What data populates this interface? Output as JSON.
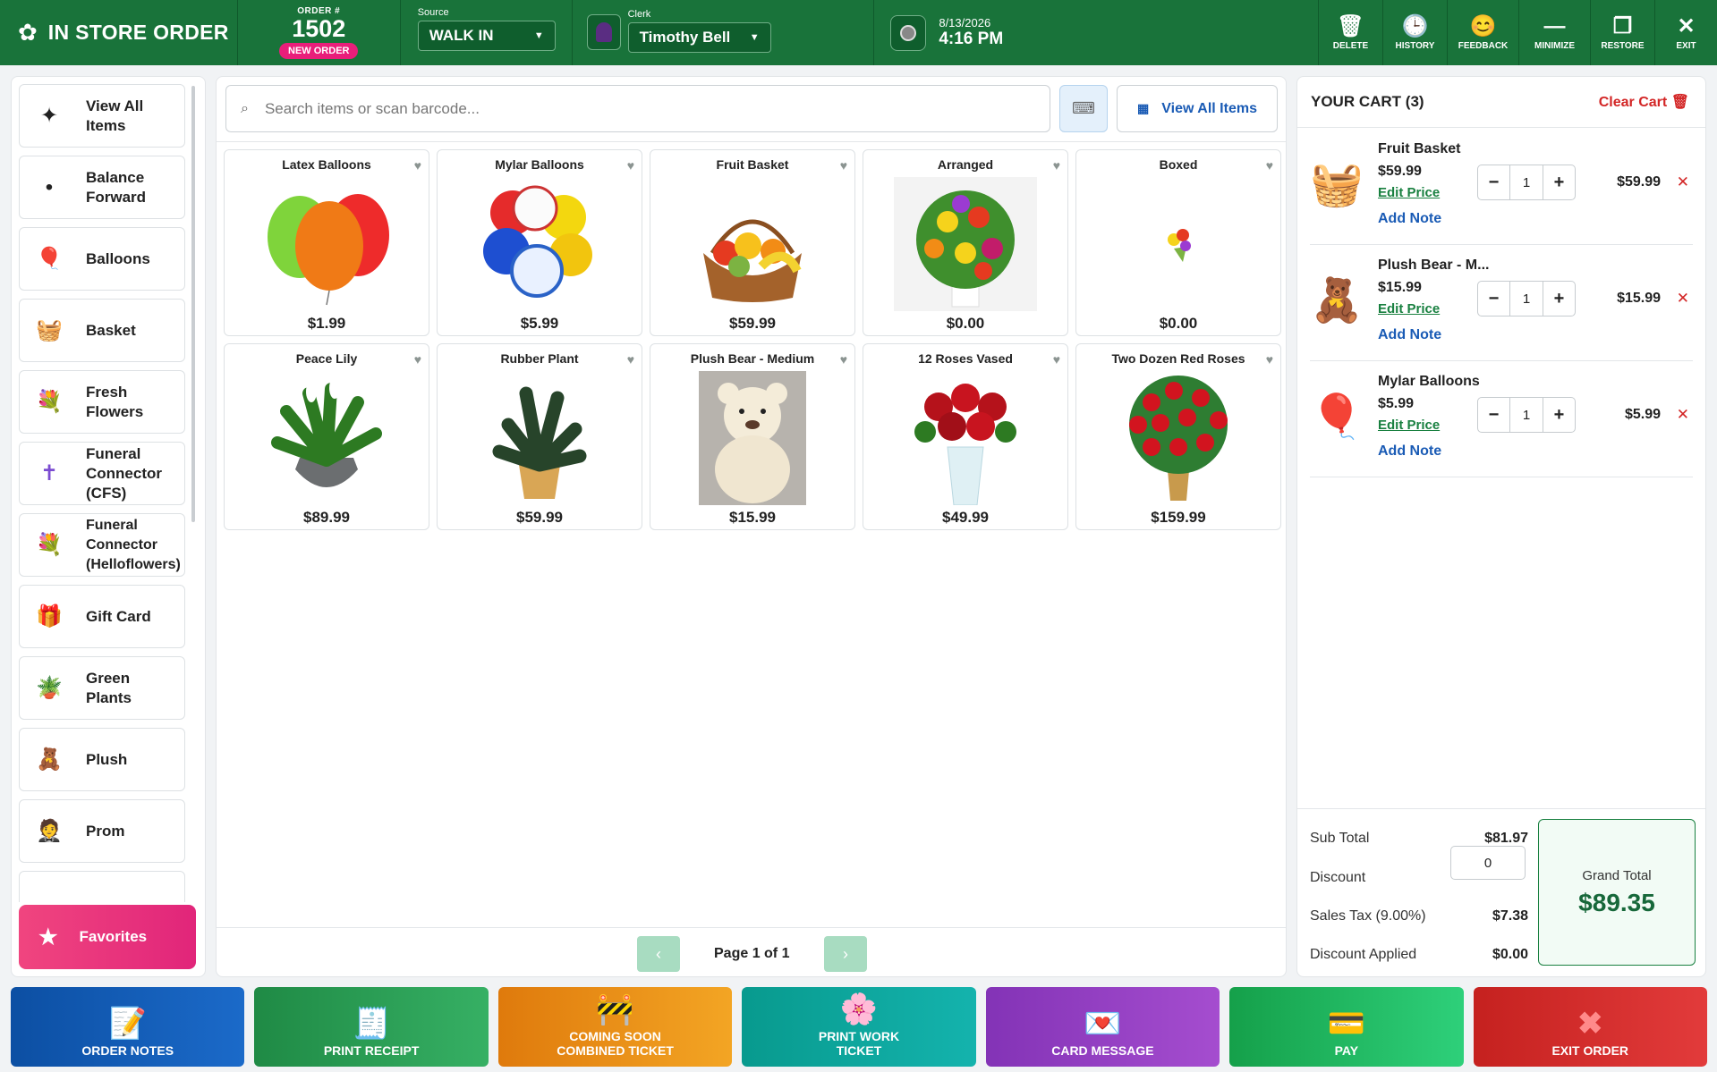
{
  "header": {
    "title": "IN STORE ORDER",
    "order_label": "ORDER #",
    "order_number": "1502",
    "order_badge": "NEW ORDER",
    "source_label": "Source",
    "source_value": "WALK IN",
    "clerk_label": "Clerk",
    "clerk_value": "Timothy Bell",
    "date": "8/13/2026",
    "time": "4:16 PM",
    "actions": {
      "delete": "DELETE",
      "history": "HISTORY",
      "feedback": "FEEDBACK",
      "minimize": "MINIMIZE",
      "restore": "RESTORE",
      "exit": "EXIT"
    }
  },
  "categories": [
    {
      "label": "View All Items",
      "icon": "sparkle-icon",
      "glyph": "✦"
    },
    {
      "label": "Balance Forward",
      "icon": "dot-icon",
      "glyph": "•"
    },
    {
      "label": "Balloons",
      "icon": "balloon-icon",
      "glyph": "🎈"
    },
    {
      "label": "Basket",
      "icon": "basket-icon",
      "glyph": "🧺"
    },
    {
      "label": "Fresh Flowers",
      "icon": "bouquet-icon",
      "glyph": "💐"
    },
    {
      "label": "Funeral Connector (CFS)",
      "icon": "cross-icon",
      "glyph": "✝"
    },
    {
      "label": "Funeral Connector (Helloflowers)",
      "icon": "bouquet-icon",
      "glyph": "💐"
    },
    {
      "label": "Gift Card",
      "icon": "gift-icon",
      "glyph": "🎁"
    },
    {
      "label": "Green Plants",
      "icon": "potted-plant-icon",
      "glyph": "🪴"
    },
    {
      "label": "Plush",
      "icon": "teddy-bear-icon",
      "glyph": "🧸"
    },
    {
      "label": "Prom",
      "icon": "prom-person-icon",
      "glyph": "🤵"
    }
  ],
  "favorites_label": "Favorites",
  "search": {
    "placeholder": "Search items or scan barcode...",
    "view_all_label": "View All Items"
  },
  "products": [
    {
      "name": "Latex Balloons",
      "price": "$1.99",
      "glyph": "🎈"
    },
    {
      "name": "Mylar Balloons",
      "price": "$5.99",
      "glyph": "🎈"
    },
    {
      "name": "Fruit Basket",
      "price": "$59.99",
      "glyph": "🧺"
    },
    {
      "name": "Arranged",
      "price": "$0.00",
      "glyph": "💐"
    },
    {
      "name": "Boxed",
      "price": "$0.00",
      "glyph": "💐"
    },
    {
      "name": "Peace Lily",
      "price": "$89.99",
      "glyph": "🪴"
    },
    {
      "name": "Rubber Plant",
      "price": "$59.99",
      "glyph": "🪴"
    },
    {
      "name": "Plush Bear - Medium",
      "price": "$15.99",
      "glyph": "🧸"
    },
    {
      "name": "12 Roses Vased",
      "price": "$49.99",
      "glyph": "🌹"
    },
    {
      "name": "Two Dozen Red Roses",
      "price": "$159.99",
      "glyph": "🌹"
    }
  ],
  "pagination": {
    "text": "Page 1 of 1",
    "prev": "‹",
    "next": "›"
  },
  "cart": {
    "title": "YOUR CART (3)",
    "clear_label": "Clear Cart",
    "edit_price_label": "Edit Price",
    "add_note_label": "Add Note",
    "items": [
      {
        "name": "Fruit Basket",
        "price": "$59.99",
        "qty": "1",
        "line_total": "$59.99",
        "glyph": "🧺"
      },
      {
        "name": "Plush Bear - M...",
        "price": "$15.99",
        "qty": "1",
        "line_total": "$15.99",
        "glyph": "🧸"
      },
      {
        "name": "Mylar Balloons",
        "price": "$5.99",
        "qty": "1",
        "line_total": "$5.99",
        "glyph": "🎈"
      }
    ],
    "totals": {
      "subtotal_label": "Sub Total",
      "subtotal": "$81.97",
      "discount_label": "Discount",
      "discount_value": "0",
      "tax_label": "Sales Tax (9.00%)",
      "tax": "$7.38",
      "discount_applied_label": "Discount Applied",
      "discount_applied": "$0.00",
      "grand_total_label": "Grand Total",
      "grand_total": "$89.35"
    }
  },
  "bottom_actions": [
    {
      "label": "ORDER NOTES",
      "glyph": "📝"
    },
    {
      "label": "PRINT RECEIPT",
      "glyph": "🧾"
    },
    {
      "label": "COMING SOON COMBINED TICKET",
      "glyph": "🚧"
    },
    {
      "label": "PRINT WORK TICKET",
      "glyph": "🌸"
    },
    {
      "label": "CARD MESSAGE",
      "glyph": "💌"
    },
    {
      "label": "PAY",
      "glyph": "💳"
    },
    {
      "label": "EXIT ORDER",
      "glyph": "✖"
    }
  ]
}
